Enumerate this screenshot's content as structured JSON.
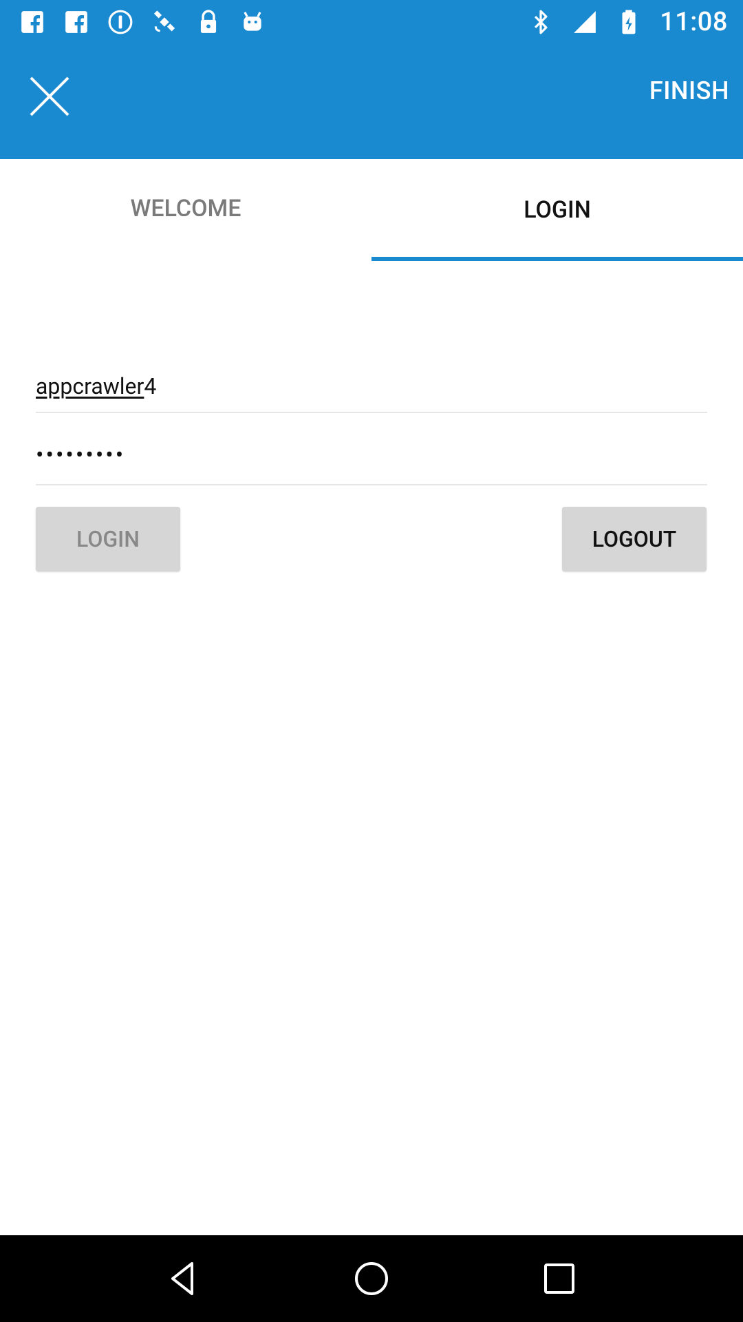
{
  "status_bar": {
    "time": "11:08",
    "left_icons": [
      "facebook-icon",
      "facebook-icon",
      "info-icon",
      "satellite-icon",
      "lock-icon",
      "android-icon"
    ],
    "right_icons": [
      "bluetooth-icon",
      "signal-strength-icon",
      "battery-icon"
    ]
  },
  "app_bar": {
    "close_icon": "close-icon",
    "finish_label": "FINISH",
    "background_color": "#1a8ad0"
  },
  "tabs": [
    {
      "label": "WELCOME",
      "active": false
    },
    {
      "label": "LOGIN",
      "active": true
    }
  ],
  "form": {
    "username_underlined": "appcrawler",
    "username_rest": "4",
    "password_masked": "•••••••••"
  },
  "buttons": {
    "login_label": "LOGIN",
    "logout_label": "LOGOUT"
  },
  "nav_bar": {
    "back_icon": "back-icon",
    "home_icon": "home-icon",
    "recents_icon": "recents-icon"
  }
}
